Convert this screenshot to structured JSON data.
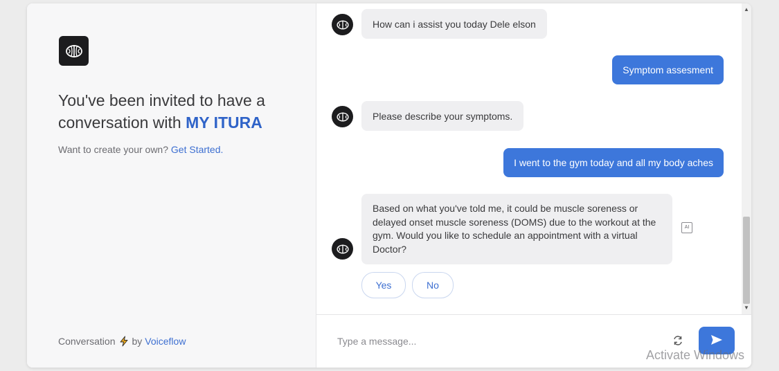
{
  "sidebar": {
    "invite_prefix": "You've been invited to have a conversation with ",
    "brand_name": "MY ITURA",
    "create_prompt": "Want to create your own? ",
    "get_started_link": "Get Started.",
    "footer_prefix": "Conversation",
    "footer_by": "by",
    "footer_brand": "Voiceflow"
  },
  "messages": [
    {
      "sender": "bot",
      "text": "How can i assist you today Dele elson"
    },
    {
      "sender": "user",
      "text": "Symptom assesment"
    },
    {
      "sender": "bot",
      "text": "Please describe your symptoms."
    },
    {
      "sender": "user",
      "text": "I went to the gym today and all my body aches"
    },
    {
      "sender": "bot",
      "text": "Based on what you've told me, it could be muscle soreness or delayed onset muscle soreness (DOMS) due to the workout at the gym. Would you like to schedule an appointment with a virtual Doctor?"
    }
  ],
  "choices": [
    "Yes",
    "No"
  ],
  "ai_badge": "AI",
  "composer": {
    "placeholder": "Type a message..."
  },
  "icons": {
    "logo": "brain-logo-icon",
    "bolt": "lightning-bolt-icon",
    "refresh": "refresh-icon",
    "send": "send-icon"
  },
  "colors": {
    "accent": "#3d77db",
    "brand_text": "#2f63c8",
    "bolt": "#e8a51c"
  },
  "watermark": "Activate Windows"
}
